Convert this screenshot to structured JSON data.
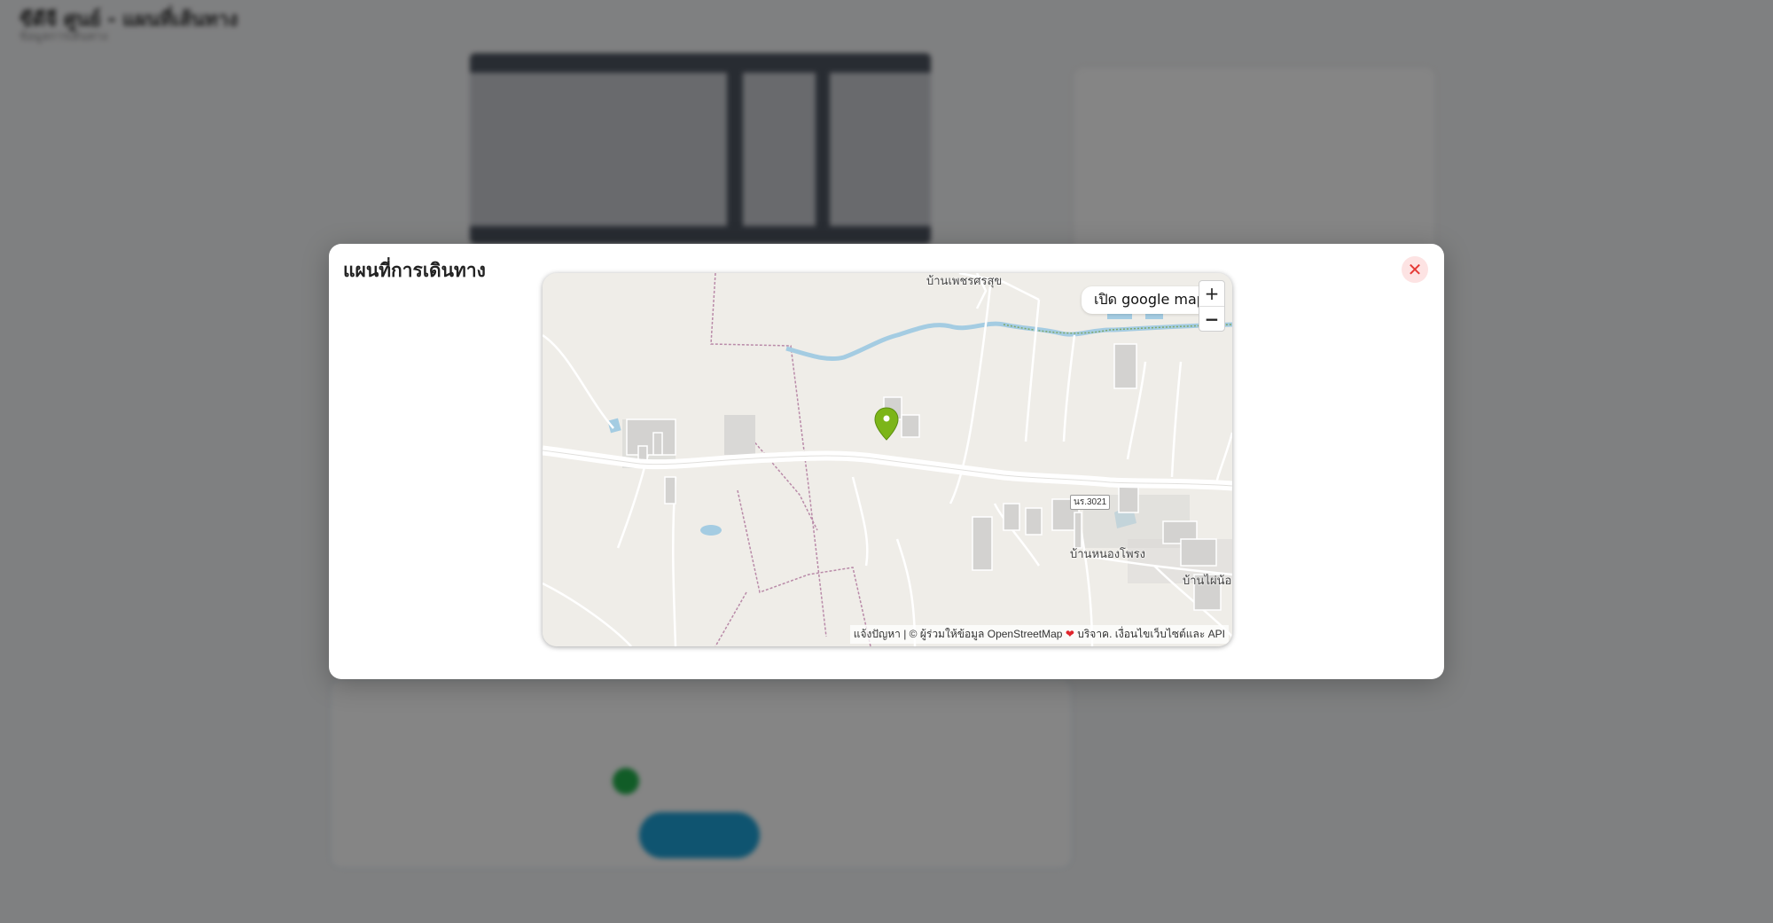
{
  "background": {
    "title": "ขีดีจี ศูนย์ - แผนที่เส้นทาง",
    "subtitle": "ข้อมูลการเดินทาง"
  },
  "modal": {
    "title": "แผนที่การเดินทาง",
    "close_icon": "close-icon"
  },
  "map": {
    "open_google_map_label": "เปิด google map",
    "zoom_in_label": "+",
    "zoom_out_label": "−",
    "attribution": {
      "report": "แจ้งปัญหา",
      "osm": "| © ผู้ร่วมให้ข้อมูล OpenStreetMap",
      "donate": "บริจาค. เงื่อนไขเว็บไซต์และ API"
    },
    "places": {
      "ban_phet_sakhon": "บ้านเพชรศรสุข",
      "ban_nong_phrong": "บ้านหนองโพรง",
      "ban_mai_nong": "บ้านไผ่น้อง"
    },
    "road_shield": "นร.3021",
    "marker_color": "#7cb518",
    "water_color": "#a4cce2"
  },
  "colors": {
    "accent": "#1ea1d6",
    "close_red": "#e53935"
  }
}
